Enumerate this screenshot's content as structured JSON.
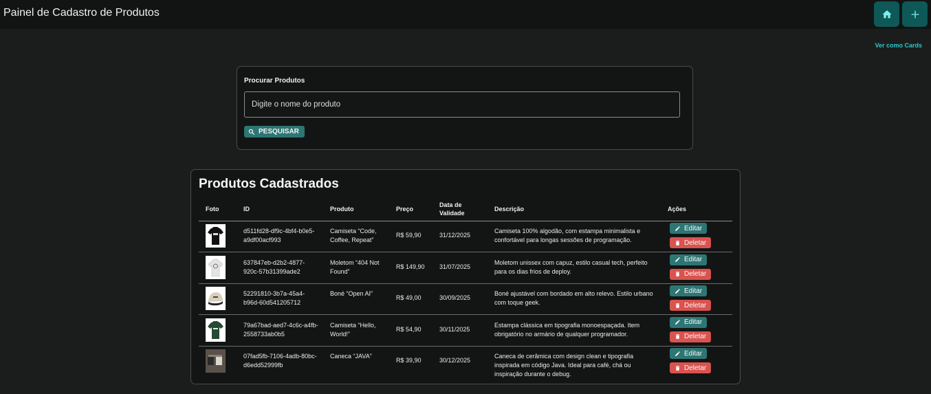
{
  "header": {
    "title": "Painel de Cadastro de Produtos",
    "home_icon": "home-icon",
    "add_icon": "plus-icon"
  },
  "view_toggle": "Ver como Cards",
  "search": {
    "label": "Procurar Produtos",
    "placeholder": "Digite o nome do produto",
    "button_label": "PESQUISAR",
    "button_icon": "search-icon"
  },
  "products": {
    "title": "Produtos Cadastrados",
    "columns": [
      "Foto",
      "ID",
      "Produto",
      "Preço",
      "Data de Validade",
      "Descrição",
      "Ações"
    ],
    "edit_label": "Editar",
    "delete_label": "Deletar",
    "rows": [
      {
        "id": "d511fd28-df9c-4bf4-b0e5-a9df00acf993",
        "name": "Camiseta “Code, Coffee, Repeat”",
        "price": "R$ 59,90",
        "expiry": "31/12/2025",
        "description": "Camiseta 100% algodão, com estampa minimalista e confortável para longas sessões de programação.",
        "photo": "black-tshirt"
      },
      {
        "id": "637847eb-d2b2-4877-920c-57b31399ade2",
        "name": "Moletom “404 Not Found”",
        "price": "R$ 149,90",
        "expiry": "31/07/2025",
        "description": "Moletom unissex com capuz, estilo casual tech, perfeito para os dias frios de deploy.",
        "photo": "white-hoodie"
      },
      {
        "id": "52291810-3b7a-45a4-b96d-60d541205712",
        "name": "Boné “Open AI”",
        "price": "R$ 49,00",
        "expiry": "30/09/2025",
        "description": "Boné ajustável com bordado em alto relevo. Estilo urbano com toque geek.",
        "photo": "cap"
      },
      {
        "id": "79a67bad-aed7-4c6c-a4fb-2558733ab0b5",
        "name": "Camiseta “Hello, World!”",
        "price": "R$ 54,90",
        "expiry": "30/11/2025",
        "description": "Estampa clássica em tipografia monoespaçada. Item obrigatório no armário de qualquer programador.",
        "photo": "green-tshirt"
      },
      {
        "id": "07fad5fb-7106-4adb-80bc-d6edd52999fb",
        "name": "Caneca “JAVA”",
        "price": "R$ 39,90",
        "expiry": "30/12/2025",
        "description": "Caneca de cerâmica com design clean e tipografia inspirada em código Java. Ideal para café, chá ou inspiração durante o debug.",
        "photo": "mugs"
      }
    ]
  },
  "colors": {
    "background": "#1b1d1d",
    "accent": "#2d7674",
    "link": "#2fc7c7",
    "danger": "#d9534f"
  }
}
